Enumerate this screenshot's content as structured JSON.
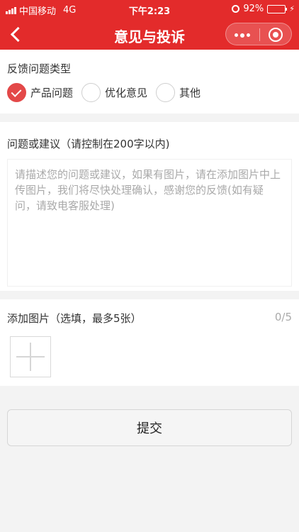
{
  "status_bar": {
    "carrier": "中国移动",
    "network": "4G",
    "time": "下午2:23",
    "battery": "92%",
    "battery_level": 0.92,
    "icons": [
      "signal-icon",
      "alarm-icon",
      "battery-icon",
      "charging-icon"
    ]
  },
  "nav": {
    "title": "意见与投诉",
    "back_icon": "chevron-left-icon",
    "more_icon": "more-dots-icon",
    "close_icon": "target-circle-icon"
  },
  "feedback_type": {
    "label": "反馈问题类型",
    "options": [
      {
        "label": "产品问题",
        "checked": true
      },
      {
        "label": "优化意见",
        "checked": false
      },
      {
        "label": "其他",
        "checked": false
      }
    ]
  },
  "suggestion": {
    "label": "问题或建议（请控制在200字以内)",
    "placeholder": "请描述您的问题或建议，如果有图片，请在添加图片中上传图片，我们将尽快处理确认，感谢您的反馈(如有疑问，请致电客服处理)",
    "value": ""
  },
  "images": {
    "label": "添加图片（选填，最多5张）",
    "count": "0/5",
    "add_icon": "plus-icon"
  },
  "submit_label": "提交",
  "colors": {
    "brand_red": "#e32b2b",
    "radio_checked": "#e34848",
    "battery_green": "#57d956"
  }
}
